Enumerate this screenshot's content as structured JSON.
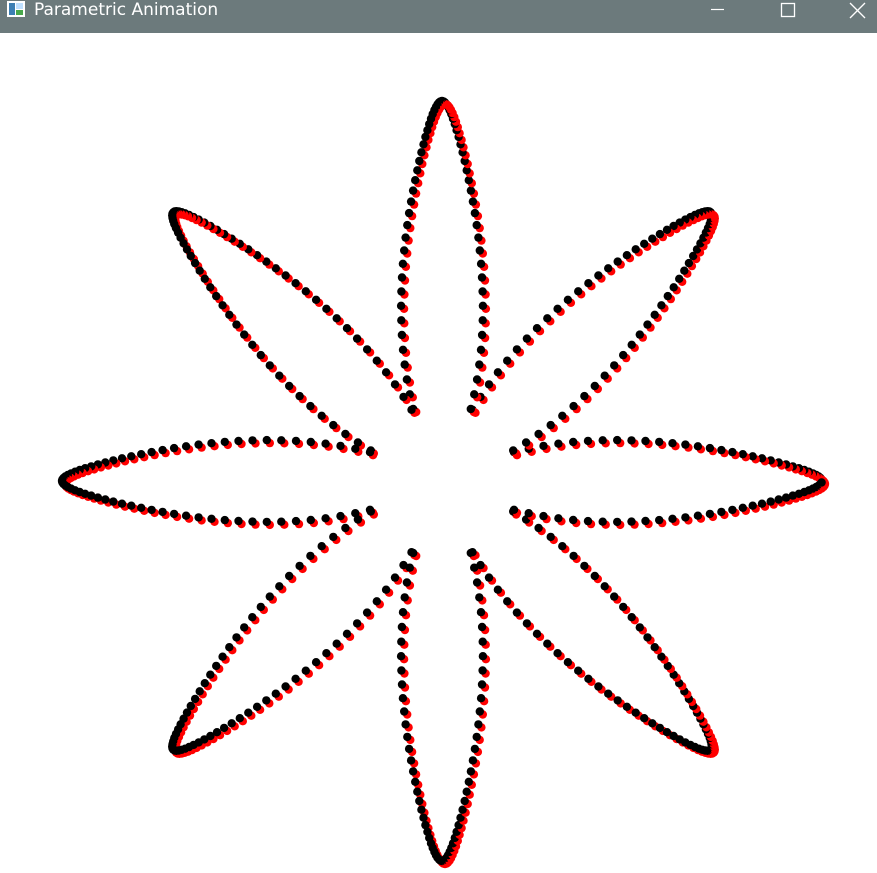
{
  "window": {
    "title": "Parametric Animation",
    "titlebar_color": "#6c7a7c",
    "title_color": "#ffffff",
    "controls": {
      "minimize_icon": "minimize-icon",
      "maximize_icon": "maximize-icon",
      "close_icon": "close-icon"
    }
  },
  "canvas": {
    "background": "#ffffff",
    "curve": {
      "type": "polar-rose",
      "petals": 8,
      "dot_color": "#000000",
      "shadow_color": "#ff0000"
    }
  }
}
